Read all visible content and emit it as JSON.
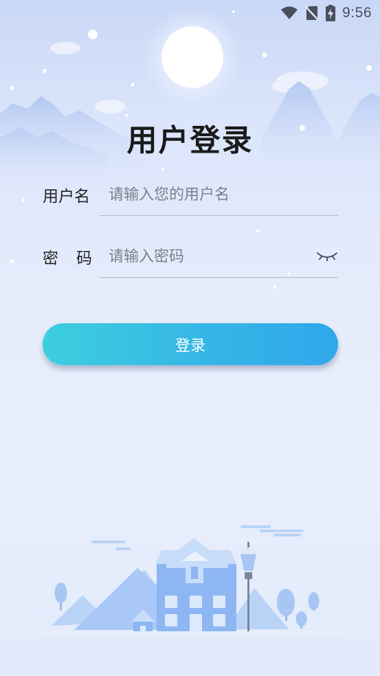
{
  "status_bar": {
    "time": "9:56",
    "icons": [
      "wifi-icon",
      "no-sim-icon",
      "battery-charging-icon"
    ]
  },
  "page": {
    "title": "用户登录"
  },
  "form": {
    "username": {
      "label": "用户名",
      "placeholder": "请输入您的用户名",
      "value": ""
    },
    "password": {
      "label_chars": [
        "密",
        "码"
      ],
      "placeholder": "请输入密码",
      "value": "",
      "toggle_icon": "eye-closed-icon"
    }
  },
  "login_button": {
    "label": "登录"
  },
  "colors": {
    "button_gradient_start": "#3ccfdf",
    "button_gradient_end": "#2fa7ea",
    "background_top": "#c9d8f7",
    "background_bottom": "#e2eafb",
    "title": "#1a1a1a"
  }
}
